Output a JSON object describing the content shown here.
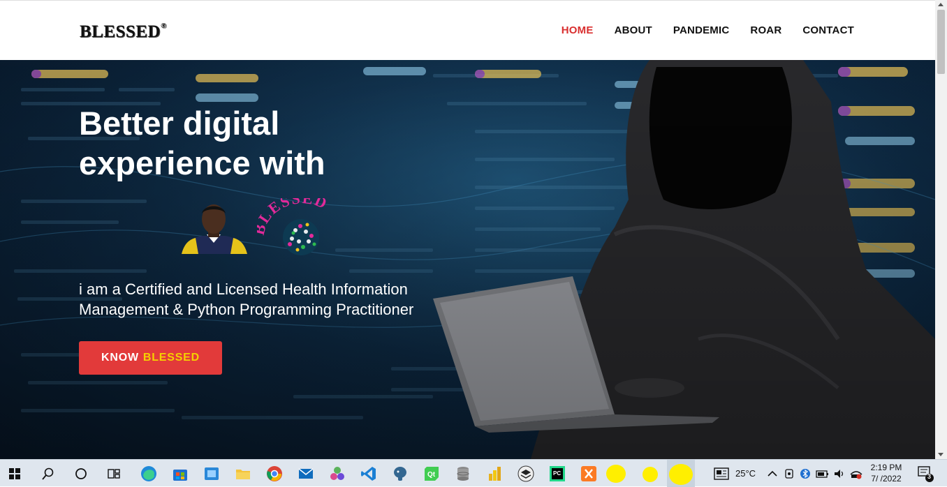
{
  "header": {
    "logo_text": "BLESSED",
    "logo_mark": "®",
    "nav": [
      {
        "label": "HOME",
        "active": true
      },
      {
        "label": "ABOUT",
        "active": false
      },
      {
        "label": "PANDEMIC",
        "active": false
      },
      {
        "label": "ROAR",
        "active": false
      },
      {
        "label": "CONTACT",
        "active": false
      }
    ]
  },
  "hero": {
    "title_line1": "Better digital",
    "title_line2": "experience with",
    "badge_text": "BLESSED",
    "subtitle_line1": "i am a Certified and Licensed Health Information",
    "subtitle_line2": "Management & Python Programming Practitioner",
    "cta_prefix": "KNOW",
    "cta_highlight": "BLESSED",
    "accent_color": "#e23a3a",
    "highlight_color": "#f5d000"
  },
  "taskbar": {
    "apps": [
      "windows-start-icon",
      "search-icon",
      "cortana-icon",
      "task-view-icon",
      "edge-icon",
      "store-icon",
      "remote-app-icon",
      "file-explorer-icon",
      "chrome-icon",
      "mail-icon",
      "app-cluster-icon",
      "vscode-icon",
      "postgres-icon",
      "qt-icon",
      "database-icon",
      "power-bi-icon",
      "stack-icon",
      "pycharm-icon",
      "xampp-icon",
      "yellow-app-icon",
      "yellow-app-icon",
      "yellow-app-icon"
    ],
    "temperature": "25°C",
    "time": "2:19 PM",
    "date": "7/ /2022",
    "notification_count": "3"
  }
}
